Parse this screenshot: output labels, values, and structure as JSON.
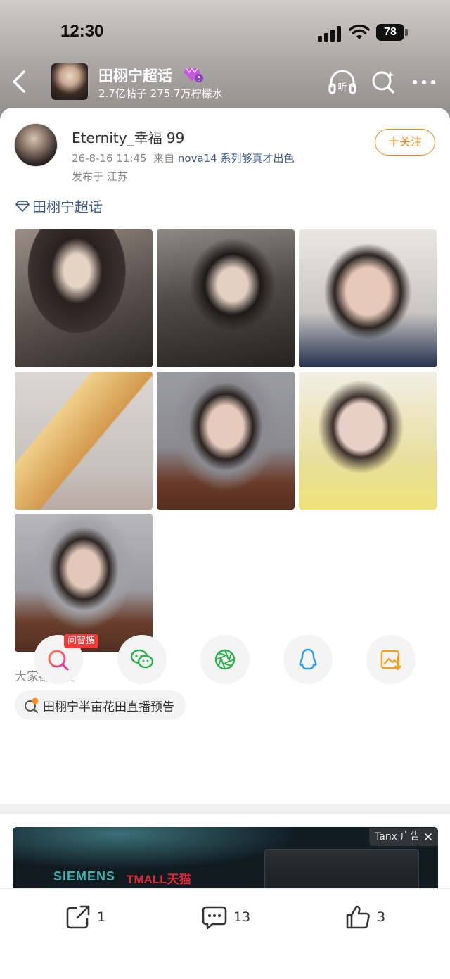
{
  "status_bar": {
    "time": "12:30",
    "battery": "78"
  },
  "header": {
    "topic_title": "田栩宁超话",
    "topic_stats": "2.7亿帖子  275.7万柠檬水"
  },
  "post": {
    "author_name": "Eternity_幸福 99",
    "timestamp": "26-8-16 11:45",
    "source_prefix": "来自",
    "source": "nova14 系列够真才出色",
    "location": "发布于 江苏",
    "follow_label": "十关注",
    "topic_tag": "田栩宁超话"
  },
  "trending": {
    "title": "大家都在搜",
    "query": "田栩宁半亩花田直播预告"
  },
  "share": {
    "ai_badge": "问智搜"
  },
  "ad": {
    "brand": "SIEMENS",
    "mall": "TMALL天猫",
    "label": "Tanx 广告"
  },
  "actions": {
    "repost_count": "1",
    "comment_count": "13",
    "like_count": "3"
  }
}
